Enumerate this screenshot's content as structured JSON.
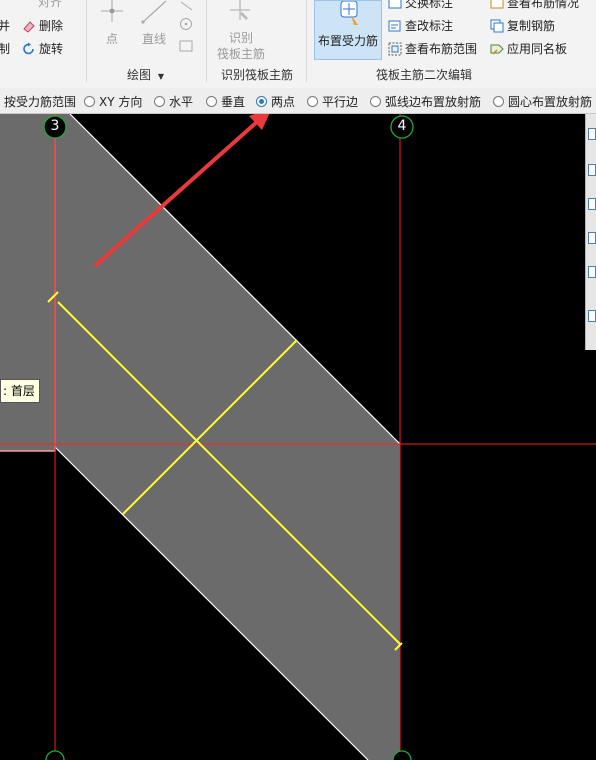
{
  "ribbon": {
    "edit_group": {
      "align": "对齐",
      "merge": "并",
      "delete": "删除",
      "split": "制",
      "rotate": "旋转"
    },
    "draw_group": {
      "point": "点",
      "line": "直线",
      "label": "绘图"
    },
    "identify_group": {
      "identify_line1": "识别",
      "identify_line2": "筏板主筋",
      "label": "识别筏板主筋"
    },
    "secondary_group": {
      "place_main_bar": "布置受力筋",
      "swap_label": "交换标注",
      "check_label": "查改标注",
      "view_range": "查看布筋范围",
      "view_status": "查看布筋情况",
      "copy_bar": "复制钢筋",
      "apply_same": "应用同名板",
      "label": "筏板主筋二次编辑"
    }
  },
  "options_bar": {
    "range_label": "按受力筋范围",
    "options": [
      {
        "label": "XY 方向",
        "selected": false
      },
      {
        "label": "水平",
        "selected": false
      },
      {
        "label": "垂直",
        "selected": false
      },
      {
        "label": "两点",
        "selected": true
      },
      {
        "label": "平行边",
        "selected": false
      },
      {
        "label": "弧线边布置放射筋",
        "selected": false
      },
      {
        "label": "圆心布置放射筋",
        "selected": false
      }
    ]
  },
  "canvas": {
    "axis_labels": {
      "axis_3": "3",
      "axis_4": "4"
    },
    "tooltip": ": 首层",
    "colors": {
      "background": "#000000",
      "slab_fill": "#6b6b6b",
      "slab_edge": "#ffffff",
      "rebar": "#ffff33",
      "axis": "#ff2020",
      "axis_marker": "#1faa3a",
      "annotation_arrow": "#e83a3a",
      "pink_border": "#ff9a9a"
    }
  }
}
